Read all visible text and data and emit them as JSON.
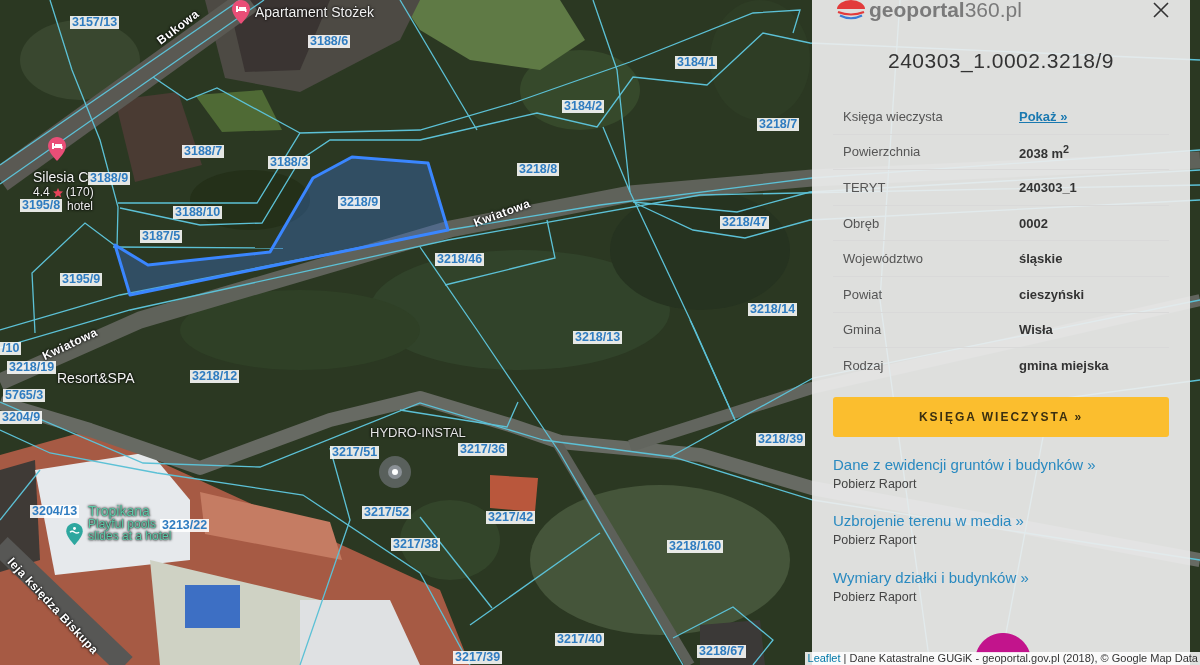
{
  "map": {
    "parcels": [
      "3157/13",
      "3188/6",
      "3184/1",
      "3184/2",
      "3218/7",
      "3188/7",
      "3188/3",
      "3218/8",
      "3188/9",
      "3218/9",
      "3195/8",
      "3188/10",
      "3218/47",
      "3187/5",
      "3218/46",
      "3195/9",
      "3218/14",
      "3218/13",
      "/10",
      "3218/19",
      "3218/12",
      "5765/3",
      "3204/9",
      "3218/39",
      "3217/36",
      "3217/51",
      "3204/13",
      "3217/52",
      "3217/42",
      "3213/22",
      "3217/38",
      "3218/160",
      "3217/40",
      "3218/67",
      "3217/39"
    ],
    "streets": [
      "Bukowa",
      "Kwiatowa",
      "Kwiatowa",
      "leja księdza Biskupa"
    ],
    "places": [
      {
        "kind": "lodging",
        "name": "Apartament Stożek"
      },
      {
        "kind": "lodging",
        "name": "Silesia C",
        "rating": "4.4",
        "reviews": "(170)",
        "category": "hotel"
      },
      {
        "kind": "water_park",
        "name": "Tropikana",
        "description": [
          "Playful pools",
          "slides at a hotel"
        ]
      },
      {
        "kind": "business",
        "name": "HYDRO-INSTAL"
      },
      {
        "kind": "label",
        "name": "Resort&SPA"
      }
    ]
  },
  "panel": {
    "logo": "**geoportal**360.pl",
    "title": "240303_1.0002.3218/9",
    "details": [
      {
        "label": "Księga wieczysta",
        "value": "Pokaż »",
        "kind": "link"
      },
      {
        "label": "Powierzchnia",
        "value": "2038 m$^{2}$",
        "kind": "text"
      },
      {
        "label": "TERYT",
        "value": "240303_1",
        "kind": "text"
      },
      {
        "label": "Obręb",
        "value": "0002",
        "kind": "text"
      },
      {
        "label": "Województwo",
        "value": "śląskie",
        "kind": "text"
      },
      {
        "label": "Powiat",
        "value": "cieszyński",
        "kind": "text"
      },
      {
        "label": "Gmina",
        "value": "Wisła",
        "kind": "text"
      },
      {
        "label": "Rodzaj",
        "value": "gmina miejska",
        "kind": "text"
      }
    ],
    "button": "KSIĘGA WIECZYSTA »",
    "reports": [
      {
        "title": "Dane z ewidencji gruntów i budynków »",
        "action": "Pobierz Raport"
      },
      {
        "title": "Uzbrojenie terenu w media »",
        "action": "Pobierz Raport"
      },
      {
        "title": "Wymiary działki i budynków »",
        "action": "Pobierz Raport"
      }
    ]
  },
  "attribution": [
    {
      "kind": "link",
      "text": "Leaflet"
    },
    {
      "kind": "text",
      "text": " | Dane Katastralne GUGiK - geoportal.gov.pl (2018), © Google Map Data"
    }
  ]
}
